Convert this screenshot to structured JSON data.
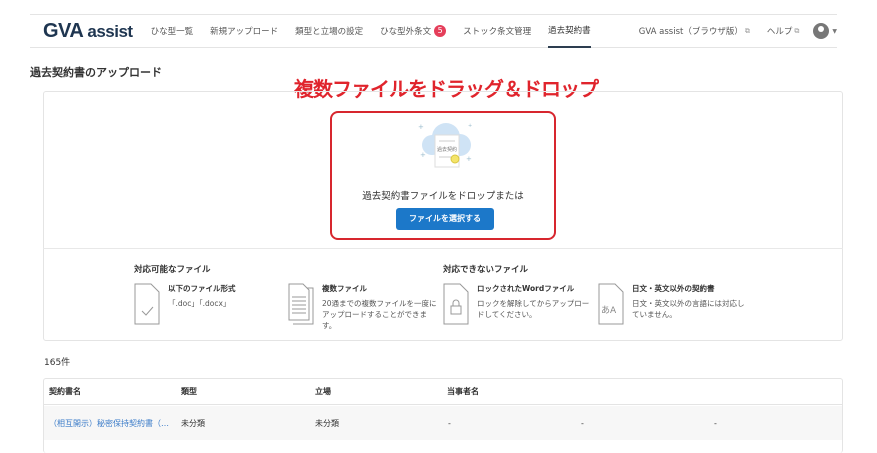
{
  "nav": {
    "logo_main": "GVA",
    "logo_sub": "assist",
    "items": [
      "ひな型一覧",
      "新規アップロード",
      "類型と立場の設定",
      "ひな型外条文",
      "ストック条文管理",
      "過去契約書"
    ],
    "badge": "5",
    "browser": "GVA assist（ブラウザ版）",
    "help": "ヘルプ"
  },
  "page": {
    "title": "過去契約書のアップロード",
    "banner": "複数ファイルをドラッグ＆ドロップ"
  },
  "dropzone": {
    "doc_label": "過去契約",
    "text": "過去契約書ファイルをドロップまたは",
    "button": "ファイルを選択する"
  },
  "supported": {
    "heading": "対応可能なファイル",
    "items": [
      {
        "title": "以下のファイル形式",
        "desc": "「.doc」「.docx」"
      },
      {
        "title": "複数ファイル",
        "desc": "20通までの複数ファイルを一度にアップロードすることができます。"
      }
    ]
  },
  "unsupported": {
    "heading": "対応できないファイル",
    "items": [
      {
        "title": "ロックされたWordファイル",
        "desc": "ロックを解除してからアップロードしてください。"
      },
      {
        "title": "日文・英文以外の契約書",
        "desc": "日文・英文以外の言語には対応していません。",
        "icon_text": "あA"
      }
    ]
  },
  "list": {
    "count": "165件",
    "headers": [
      "契約書名",
      "類型",
      "立場",
      "当事者名"
    ],
    "rows": [
      {
        "name": "（相互開示）秘密保持契約書（…",
        "type": "未分類",
        "position": "未分類",
        "p1": "-",
        "p2": "-",
        "p3": "-"
      }
    ]
  },
  "colors": {
    "accent": "#1c78c9",
    "banner": "#e0242c",
    "badge": "#e53e5a"
  }
}
